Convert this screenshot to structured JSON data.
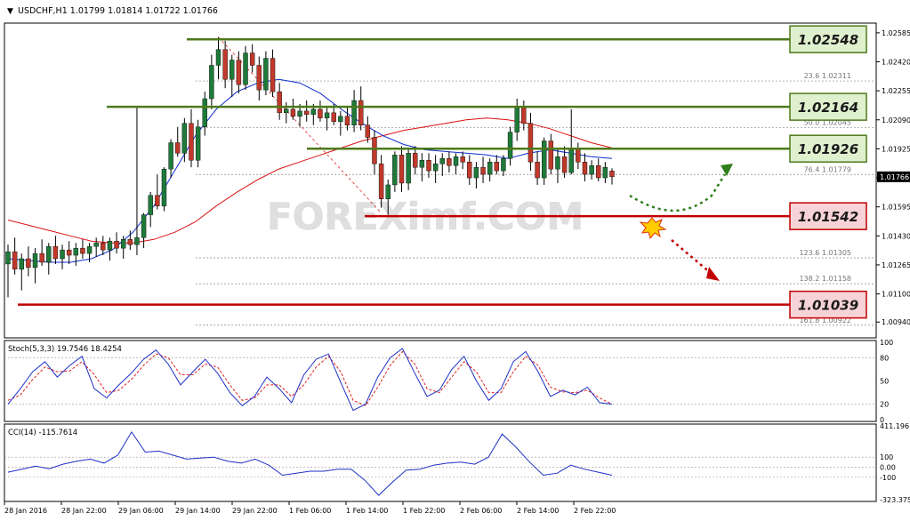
{
  "header": {
    "symbol_line": "USDCHF,H1  1.01799 1.01814 1.01722 1.01766"
  },
  "watermark": "FOREXimf.COM",
  "colors": {
    "background": "#ffffff",
    "axis": "#000000",
    "bull_candle": "#1f7a3a",
    "bear_candle": "#c0392b",
    "sma_fast": "#0b2ccf",
    "sma_slow": "#dd1111",
    "support_line": "#c00000",
    "resistance_line": "#4d7a1a",
    "label_green_bg": "#dff0cf",
    "label_red_bg": "#f6d3d6",
    "fib_line": "#8a8a8a",
    "stoch_main": "#1e2fc6",
    "stoch_signal": "#e02020",
    "cci": "#1e2fc6"
  },
  "chart_data": {
    "type": "candlestick",
    "symbol": "USDCHF",
    "timeframe": "H1",
    "last_bar": {
      "open": 1.01799,
      "high": 1.01814,
      "low": 1.01722,
      "close": 1.01766
    },
    "price_axis": {
      "ticks": [
        "1.02585",
        "1.02420",
        "1.02255",
        "1.02090",
        "1.01925",
        "1.01760",
        "1.01595",
        "1.01430",
        "1.01265",
        "1.01100",
        "1.00940"
      ],
      "current_price": "1.01766",
      "range": [
        1.0085,
        1.0264
      ]
    },
    "time_axis": {
      "labels": [
        "28 Jan 2016",
        "28 Jan 22:00",
        "29 Jan 06:00",
        "29 Jan 14:00",
        "29 Jan 22:00",
        "1 Feb 06:00",
        "1 Feb 14:00",
        "1 Feb 22:00",
        "2 Feb 06:00",
        "2 Feb 14:00",
        "2 Feb 22:00"
      ]
    },
    "candles": [
      [
        1.0127,
        1.0138,
        1.0108,
        1.0134
      ],
      [
        1.0134,
        1.0142,
        1.0121,
        1.0124
      ],
      [
        1.0124,
        1.0133,
        1.0112,
        1.013
      ],
      [
        1.013,
        1.0137,
        1.012,
        1.0125
      ],
      [
        1.0125,
        1.0136,
        1.0116,
        1.0133
      ],
      [
        1.0133,
        1.0141,
        1.0126,
        1.0128
      ],
      [
        1.0128,
        1.0139,
        1.0121,
        1.0137
      ],
      [
        1.0137,
        1.0143,
        1.0127,
        1.013
      ],
      [
        1.013,
        1.0138,
        1.0124,
        1.0135
      ],
      [
        1.0135,
        1.014,
        1.0127,
        1.0132
      ],
      [
        1.0132,
        1.0139,
        1.0126,
        1.0136
      ],
      [
        1.0136,
        1.0141,
        1.013,
        1.0133
      ],
      [
        1.0133,
        1.0139,
        1.0128,
        1.0137
      ],
      [
        1.0137,
        1.0142,
        1.0131,
        1.0139
      ],
      [
        1.0139,
        1.0143,
        1.0132,
        1.0135
      ],
      [
        1.0135,
        1.0142,
        1.0129,
        1.014
      ],
      [
        1.014,
        1.0145,
        1.0133,
        1.0136
      ],
      [
        1.0136,
        1.0143,
        1.013,
        1.0141
      ],
      [
        1.0141,
        1.0146,
        1.0135,
        1.0138
      ],
      [
        1.0138,
        1.0216,
        1.0132,
        1.0142
      ],
      [
        1.0142,
        1.0156,
        1.0136,
        1.0155
      ],
      [
        1.0155,
        1.0168,
        1.0148,
        1.0166
      ],
      [
        1.0166,
        1.0178,
        1.0158,
        1.016
      ],
      [
        1.016,
        1.0182,
        1.0157,
        1.0181
      ],
      [
        1.0181,
        1.0198,
        1.0176,
        1.0196
      ],
      [
        1.0196,
        1.0205,
        1.0188,
        1.019
      ],
      [
        1.019,
        1.021,
        1.0185,
        1.0207
      ],
      [
        1.0207,
        1.0215,
        1.0182,
        1.0186
      ],
      [
        1.0186,
        1.0209,
        1.0182,
        1.0205
      ],
      [
        1.0205,
        1.0225,
        1.02,
        1.0221
      ],
      [
        1.0221,
        1.0246,
        1.0215,
        1.024
      ],
      [
        1.024,
        1.0256,
        1.0232,
        1.0249
      ],
      [
        1.0249,
        1.0254,
        1.0227,
        1.0232
      ],
      [
        1.0232,
        1.0246,
        1.0222,
        1.0243
      ],
      [
        1.0243,
        1.0248,
        1.0224,
        1.0229
      ],
      [
        1.0229,
        1.0251,
        1.0226,
        1.0247
      ],
      [
        1.0247,
        1.0252,
        1.0236,
        1.024
      ],
      [
        1.024,
        1.0245,
        1.022,
        1.0226
      ],
      [
        1.0226,
        1.0248,
        1.0223,
        1.0244
      ],
      [
        1.0244,
        1.0249,
        1.0222,
        1.0225
      ],
      [
        1.0225,
        1.023,
        1.0209,
        1.0213
      ],
      [
        1.0213,
        1.0219,
        1.0207,
        1.0215
      ],
      [
        1.0215,
        1.0221,
        1.0209,
        1.0211
      ],
      [
        1.0211,
        1.0218,
        1.0205,
        1.0214
      ],
      [
        1.0214,
        1.022,
        1.0208,
        1.0212
      ],
      [
        1.0212,
        1.0218,
        1.0206,
        1.0215
      ],
      [
        1.0215,
        1.022,
        1.0208,
        1.021
      ],
      [
        1.021,
        1.0216,
        1.0203,
        1.0213
      ],
      [
        1.0213,
        1.0218,
        1.0206,
        1.0208
      ],
      [
        1.0208,
        1.0214,
        1.02,
        1.0211
      ],
      [
        1.0211,
        1.0217,
        1.0203,
        1.0206
      ],
      [
        1.0206,
        1.0226,
        1.0202,
        1.022
      ],
      [
        1.022,
        1.0228,
        1.0203,
        1.0206
      ],
      [
        1.0206,
        1.0211,
        1.0196,
        1.0199
      ],
      [
        1.0199,
        1.0203,
        1.0178,
        1.0184
      ],
      [
        1.0184,
        1.0189,
        1.0159,
        1.0164
      ],
      [
        1.0164,
        1.0175,
        1.0155,
        1.0172
      ],
      [
        1.0172,
        1.0191,
        1.0168,
        1.0189
      ],
      [
        1.0189,
        1.0194,
        1.0168,
        1.0173
      ],
      [
        1.0173,
        1.0192,
        1.0169,
        1.019
      ],
      [
        1.019,
        1.0194,
        1.0178,
        1.0182
      ],
      [
        1.0182,
        1.019,
        1.0174,
        1.0186
      ],
      [
        1.0186,
        1.019,
        1.0176,
        1.018
      ],
      [
        1.018,
        1.0189,
        1.0173,
        1.0184
      ],
      [
        1.0184,
        1.019,
        1.0177,
        1.0187
      ],
      [
        1.0187,
        1.0191,
        1.0179,
        1.0183
      ],
      [
        1.0183,
        1.019,
        1.0178,
        1.0188
      ],
      [
        1.0188,
        1.0191,
        1.0181,
        1.0185
      ],
      [
        1.0185,
        1.0189,
        1.0172,
        1.0176
      ],
      [
        1.0176,
        1.0185,
        1.017,
        1.0182
      ],
      [
        1.0182,
        1.0188,
        1.0173,
        1.0178
      ],
      [
        1.0178,
        1.0187,
        1.0174,
        1.0185
      ],
      [
        1.0185,
        1.0189,
        1.0178,
        1.018
      ],
      [
        1.018,
        1.0189,
        1.0177,
        1.0187
      ],
      [
        1.0187,
        1.0205,
        1.0183,
        1.0202
      ],
      [
        1.0202,
        1.0221,
        1.0197,
        1.0216
      ],
      [
        1.0216,
        1.022,
        1.0203,
        1.0207
      ],
      [
        1.0207,
        1.0213,
        1.018,
        1.0185
      ],
      [
        1.0185,
        1.0191,
        1.0172,
        1.0176
      ],
      [
        1.0176,
        1.0199,
        1.0172,
        1.0197
      ],
      [
        1.0197,
        1.0201,
        1.0178,
        1.0181
      ],
      [
        1.0181,
        1.0192,
        1.0173,
        1.0188
      ],
      [
        1.0188,
        1.0194,
        1.0176,
        1.0179
      ],
      [
        1.0179,
        1.0215,
        1.0178,
        1.0193
      ],
      [
        1.0193,
        1.0196,
        1.0181,
        1.0185
      ],
      [
        1.0185,
        1.019,
        1.0174,
        1.0178
      ],
      [
        1.0178,
        1.0186,
        1.0175,
        1.0183
      ],
      [
        1.0183,
        1.0187,
        1.0174,
        1.0176
      ],
      [
        1.0176,
        1.0185,
        1.0173,
        1.0182
      ],
      [
        1.01799,
        1.01814,
        1.01722,
        1.01766
      ]
    ],
    "sma_fast_values": [
      1.013,
      1.0129,
      1.0128,
      1.0128,
      1.013,
      1.0135,
      1.0145,
      1.016,
      1.018,
      1.02,
      1.0215,
      1.0225,
      1.023,
      1.0232,
      1.023,
      1.0224,
      1.0215,
      1.0207,
      1.02,
      1.0195,
      1.0192,
      1.0191,
      1.019,
      1.0189,
      1.0187,
      1.019,
      1.0192,
      1.019,
      1.0188,
      1.0187
    ],
    "sma_slow_values": [
      1.0152,
      1.0149,
      1.0146,
      1.0143,
      1.014,
      1.0139,
      1.0139,
      1.0141,
      1.0145,
      1.0151,
      1.016,
      1.0168,
      1.0175,
      1.0181,
      1.0185,
      1.0189,
      1.0193,
      1.0197,
      1.02,
      1.0203,
      1.0205,
      1.0207,
      1.0209,
      1.021,
      1.0209,
      1.0207,
      1.0204,
      1.02,
      1.0196,
      1.0193
    ],
    "fibonacci_levels": [
      {
        "ratio": "23.6",
        "price": "1.02311"
      },
      {
        "ratio": "50.0",
        "price": "1.02045"
      },
      {
        "ratio": "76.4",
        "price": "1.01779"
      },
      {
        "ratio": "123.6",
        "price": "1.01305"
      },
      {
        "ratio": "138.2",
        "price": "1.01158"
      },
      {
        "ratio": "161.8",
        "price": "1.00922"
      }
    ],
    "key_levels": [
      {
        "name": "resistance",
        "value": 1.02548,
        "label": "1.02548"
      },
      {
        "name": "resistance",
        "value": 1.02164,
        "label": "1.02164"
      },
      {
        "name": "resistance",
        "value": 1.01926,
        "label": "1.01926"
      },
      {
        "name": "support",
        "value": 1.01542,
        "label": "1.01542"
      },
      {
        "name": "support",
        "value": 1.01039,
        "label": "1.01039"
      }
    ],
    "stochastic": {
      "label": "Stoch(5,3,3) 19.7546 18.4254",
      "axis_ticks": [
        "100",
        "80",
        "50",
        "20",
        "0"
      ],
      "range": [
        0,
        100
      ],
      "main": [
        20,
        40,
        62,
        75,
        55,
        70,
        82,
        40,
        28,
        45,
        60,
        78,
        90,
        72,
        45,
        62,
        78,
        60,
        35,
        18,
        30,
        55,
        40,
        22,
        58,
        78,
        85,
        48,
        12,
        20,
        55,
        80,
        92,
        60,
        30,
        38,
        65,
        82,
        50,
        25,
        40,
        75,
        88,
        62,
        30,
        38,
        32,
        42,
        22,
        20
      ],
      "signal": [
        25,
        32,
        52,
        68,
        62,
        63,
        75,
        58,
        35,
        38,
        52,
        70,
        85,
        80,
        58,
        58,
        72,
        68,
        45,
        25,
        28,
        45,
        45,
        30,
        45,
        68,
        82,
        62,
        25,
        18,
        42,
        70,
        88,
        72,
        40,
        35,
        55,
        75,
        62,
        35,
        35,
        62,
        82,
        70,
        42,
        36,
        35,
        38,
        28,
        20
      ]
    },
    "cci": {
      "label": "CCI(14) -115.7614",
      "axis_ticks": [
        "411.196",
        "100",
        "0.00",
        "-100",
        "-323.375"
      ],
      "range": [
        -323.375,
        411.196
      ],
      "values": [
        -50,
        -20,
        10,
        -15,
        30,
        60,
        80,
        40,
        120,
        350,
        150,
        160,
        120,
        80,
        90,
        100,
        60,
        40,
        80,
        20,
        -80,
        -60,
        -40,
        -40,
        -20,
        -20,
        -130,
        -280,
        -150,
        -30,
        -20,
        20,
        40,
        50,
        30,
        100,
        330,
        200,
        50,
        -80,
        -60,
        20,
        -20,
        -50,
        -80
      ]
    },
    "annotations": [
      {
        "type": "arrow",
        "direction": "up",
        "style": "dotted",
        "color": "#2f7d1a"
      },
      {
        "type": "arrow",
        "direction": "down",
        "style": "dotted",
        "color": "#c00000"
      },
      {
        "type": "explosion-icon"
      }
    ]
  }
}
